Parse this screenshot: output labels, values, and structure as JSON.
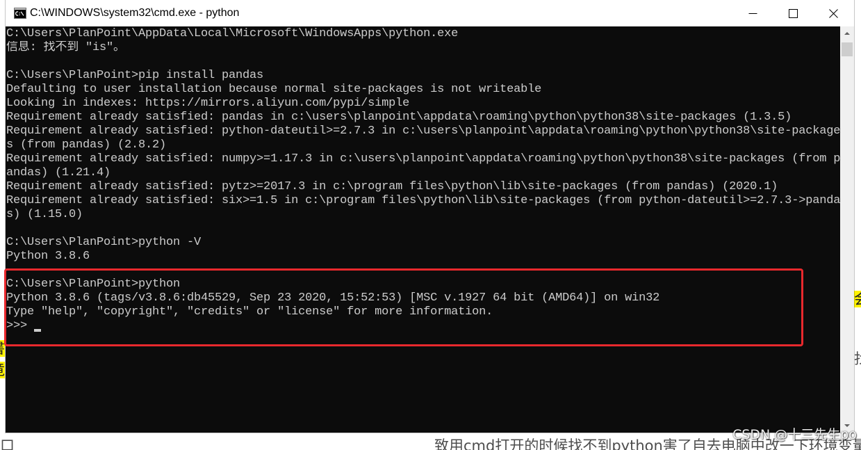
{
  "window": {
    "title": "C:\\WINDOWS\\system32\\cmd.exe - python",
    "app_icon": "cmd-icon",
    "caption_icons": [
      "minimize-icon",
      "maximize-icon",
      "close-icon"
    ]
  },
  "console": {
    "lines": [
      "C:\\Users\\PlanPoint\\AppData\\Local\\Microsoft\\WindowsApps\\python.exe",
      "信息: 找不到 \"is\"。",
      "",
      "C:\\Users\\PlanPoint>pip install pandas",
      "Defaulting to user installation because normal site-packages is not writeable",
      "Looking in indexes: https://mirrors.aliyun.com/pypi/simple",
      "Requirement already satisfied: pandas in c:\\users\\planpoint\\appdata\\roaming\\python\\python38\\site-packages (1.3.5)",
      "Requirement already satisfied: python-dateutil>=2.7.3 in c:\\users\\planpoint\\appdata\\roaming\\python\\python38\\site-package",
      "s (from pandas) (2.8.2)",
      "Requirement already satisfied: numpy>=1.17.3 in c:\\users\\planpoint\\appdata\\roaming\\python\\python38\\site-packages (from p",
      "andas) (1.21.4)",
      "Requirement already satisfied: pytz>=2017.3 in c:\\program files\\python\\lib\\site-packages (from pandas) (2020.1)",
      "Requirement already satisfied: six>=1.5 in c:\\program files\\python\\lib\\site-packages (from python-dateutil>=2.7.3->panda",
      "s) (1.15.0)",
      "",
      "C:\\Users\\PlanPoint>python -V",
      "Python 3.8.6",
      "",
      "C:\\Users\\PlanPoint>python",
      "Python 3.8.6 (tags/v3.8.6:db45529, Sep 23 2020, 15:52:53) [MSC v.1927 64 bit (AMD64)] on win32",
      "Type \"help\", \"copyright\", \"credits\" or \"license\" for more information.",
      ">>> "
    ],
    "cursor_visible": true
  },
  "scrollbar": {
    "position_fraction": 0.0,
    "up_icon": "arrow-up-icon",
    "down_icon": "arrow-down-icon"
  },
  "annotation": {
    "color": "#e8292d"
  },
  "background_page": {
    "left_edge_fragments": [
      "書",
      "竟"
    ],
    "right_edge_fragments": [
      "会",
      "找"
    ],
    "bottom_left_fragment": "口",
    "bottom_text": [
      "致用cmd打开的时候找不到python害了自",
      "去电脑中改一下环境变量"
    ],
    "watermark": "CSDN @十三先生po"
  },
  "colors": {
    "page_background": "#ffffff",
    "page_text": "#4d4d4d",
    "highlight": "#fff200",
    "titlebar_background": "#ffffff",
    "title_text": "#000000",
    "console_background": "#0c0c0c",
    "console_text": "#cccccc",
    "scrollbar_track": "#f0f0f0",
    "scrollbar_thumb": "#cdcdcd"
  }
}
